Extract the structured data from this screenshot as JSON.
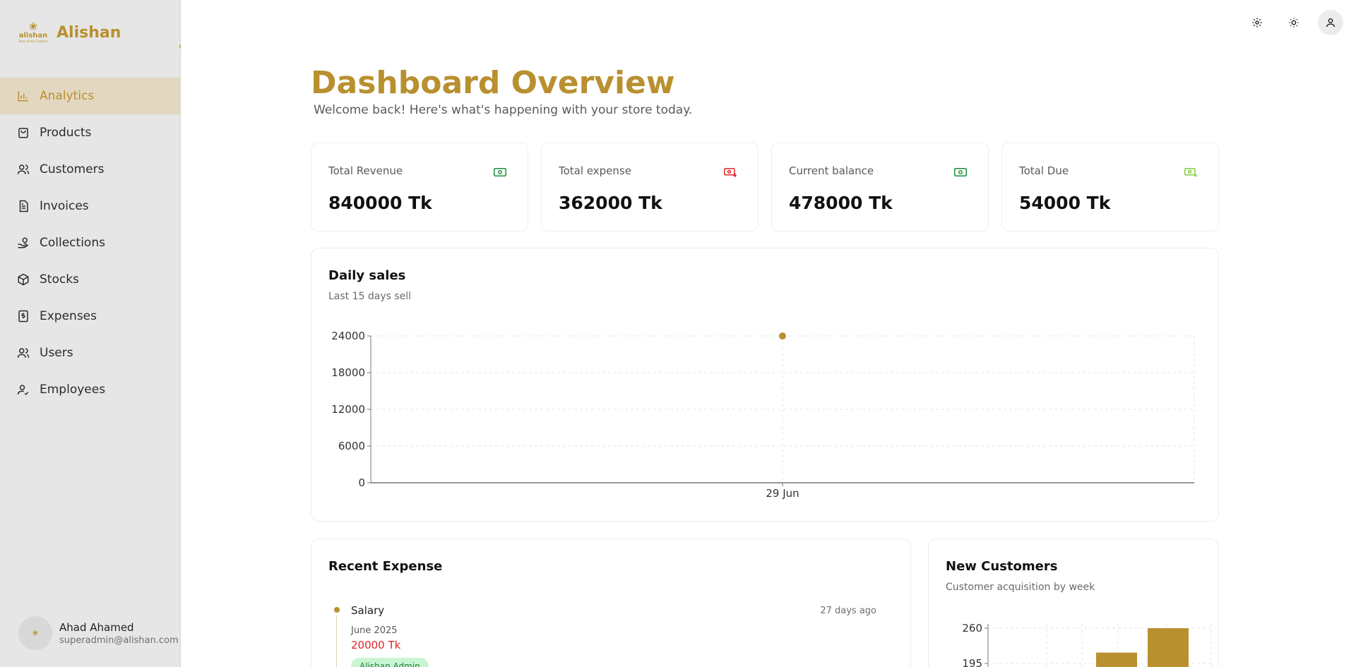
{
  "brand": {
    "name": "Alishan",
    "logo_word": "alishan",
    "logo_tag": "Taste of the Tradition"
  },
  "sidebar": {
    "collapse_icon": "chevron-left-icon",
    "items": [
      {
        "label": "Analytics",
        "icon": "bar-chart-icon",
        "active": true
      },
      {
        "label": "Products",
        "icon": "shopping-bag-icon",
        "active": false
      },
      {
        "label": "Customers",
        "icon": "users-icon",
        "active": false
      },
      {
        "label": "Invoices",
        "icon": "file-text-icon",
        "active": false
      },
      {
        "label": "Collections",
        "icon": "hand-coins-icon",
        "active": false
      },
      {
        "label": "Stocks",
        "icon": "package-icon",
        "active": false
      },
      {
        "label": "Expenses",
        "icon": "receipt-dollar-icon",
        "active": false
      },
      {
        "label": "Users",
        "icon": "users-icon",
        "active": false
      },
      {
        "label": "Employees",
        "icon": "user-check-icon",
        "active": false
      }
    ],
    "user": {
      "name": "Ahad Ahamed",
      "email": "superadmin@alishan.com"
    }
  },
  "topbar": {
    "icons": [
      "gear-icon",
      "sun-icon",
      "user-icon"
    ]
  },
  "page": {
    "title": "Dashboard Overview",
    "subtitle": "Welcome back! Here's what's happening with your store today."
  },
  "stats": [
    {
      "label": "Total Revenue",
      "value": "840000 Tk",
      "icon": "banknote-icon",
      "color": "#1a8f3a"
    },
    {
      "label": "Total expense",
      "value": "362000 Tk",
      "icon": "banknote-arrow-down-icon",
      "color": "#e0242a"
    },
    {
      "label": "Current balance",
      "value": "478000 Tk",
      "icon": "banknote-icon",
      "color": "#1a8f3a"
    },
    {
      "label": "Total Due",
      "value": "54000 Tk",
      "icon": "banknote-x-icon",
      "color": "#7fcf3a"
    }
  ],
  "daily_sales": {
    "title": "Daily sales",
    "subtitle": "Last 15 days sell"
  },
  "recent_expense": {
    "title": "Recent Expense",
    "items": [
      {
        "title": "Salary",
        "time_ago": "27 days ago",
        "date": "June 2025",
        "amount": "20000 Tk",
        "badge": "Alishan Admin"
      }
    ]
  },
  "new_customers": {
    "title": "New Customers",
    "subtitle": "Customer acquisition by week"
  },
  "colors": {
    "accent": "#b8902f",
    "active_bg": "#e2d7c0",
    "sidebar_bg": "#e6e6e6"
  },
  "chart_data": [
    {
      "type": "line",
      "title": "Daily sales",
      "subtitle": "Last 15 days sell",
      "categories": [
        "29 Jun"
      ],
      "values": [
        24000
      ],
      "ylim": [
        0,
        24000
      ],
      "yticks": [
        0,
        6000,
        12000,
        18000,
        24000
      ],
      "grid": true
    },
    {
      "type": "bar",
      "title": "New Customers",
      "subtitle": "Customer acquisition by week",
      "yticks_visible": [
        195,
        260
      ],
      "visible_bars": [
        215,
        260
      ],
      "grid": true
    }
  ]
}
